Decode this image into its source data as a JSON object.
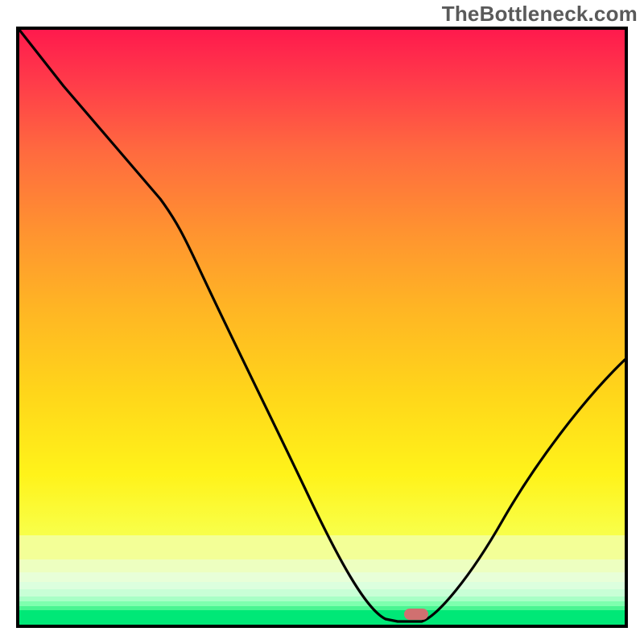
{
  "watermark": {
    "text": "TheBottleneck.com"
  },
  "colors": {
    "frame": "#000000",
    "marker": "#d07070",
    "green_strip": "#00e877"
  },
  "chart_data": {
    "type": "line",
    "title": "",
    "xlabel": "",
    "ylabel": "",
    "xlim": [
      0,
      100
    ],
    "ylim": [
      0,
      100
    ],
    "grid": false,
    "series": [
      {
        "name": "bottleneck-curve",
        "x": [
          0,
          5,
          10,
          15,
          20,
          25,
          30,
          35,
          40,
          45,
          50,
          55,
          60,
          62,
          64,
          66,
          70,
          75,
          80,
          85,
          90,
          95,
          100
        ],
        "y": [
          100,
          92,
          84,
          76,
          68,
          64,
          56,
          47,
          38,
          30,
          22,
          14,
          4,
          1,
          0,
          0,
          4,
          12,
          22,
          32,
          42,
          51,
          58
        ]
      }
    ],
    "marker_point": {
      "x": 65,
      "y": 0
    },
    "background_gradient_stops": [
      {
        "pos": 0.0,
        "color": "#ff1a4d"
      },
      {
        "pos": 0.5,
        "color": "#ffb524"
      },
      {
        "pos": 0.85,
        "color": "#f8ff4a"
      },
      {
        "pos": 0.97,
        "color": "#d8ffd0"
      },
      {
        "pos": 1.0,
        "color": "#00e877"
      }
    ]
  }
}
